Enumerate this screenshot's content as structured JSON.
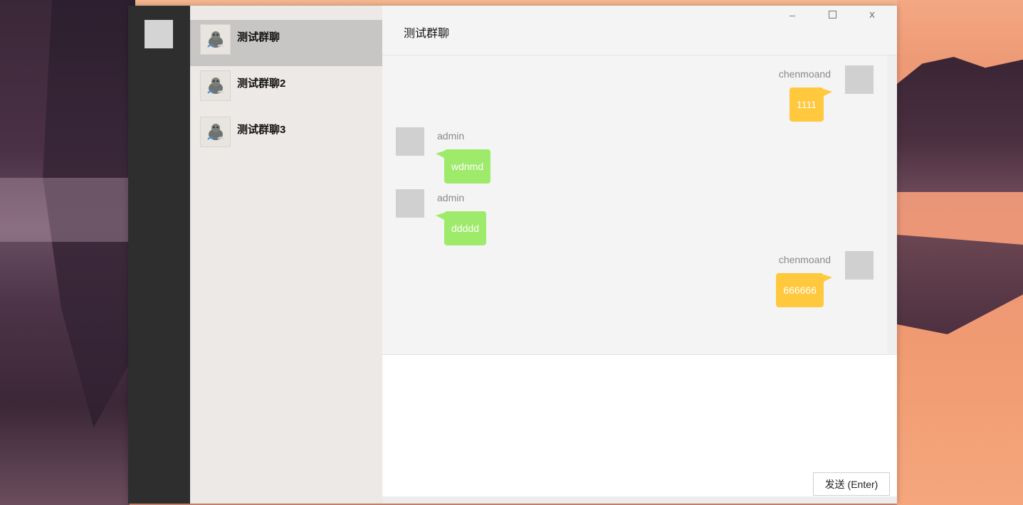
{
  "chat_list": [
    {
      "name": "测试群聊",
      "active": true
    },
    {
      "name": "测试群聊2",
      "active": false
    },
    {
      "name": "测试群聊3",
      "active": false
    }
  ],
  "header": {
    "title": "测试群聊"
  },
  "window_controls": {
    "minimize": "–",
    "close": "x"
  },
  "messages": [
    {
      "sender": "chenmoand",
      "text": "1111",
      "side": "right"
    },
    {
      "sender": "admin",
      "text": "wdnmd",
      "side": "left"
    },
    {
      "sender": "admin",
      "text": "ddddd",
      "side": "left"
    },
    {
      "sender": "chenmoand",
      "text": "666666",
      "side": "right"
    }
  ],
  "composer": {
    "send_label": "发送 (Enter)"
  },
  "colors": {
    "own_bubble": "#ffc83d",
    "other_bubble": "#9eea6a",
    "active_chat": "#c8c6c4",
    "rail": "#2e2e2e"
  }
}
